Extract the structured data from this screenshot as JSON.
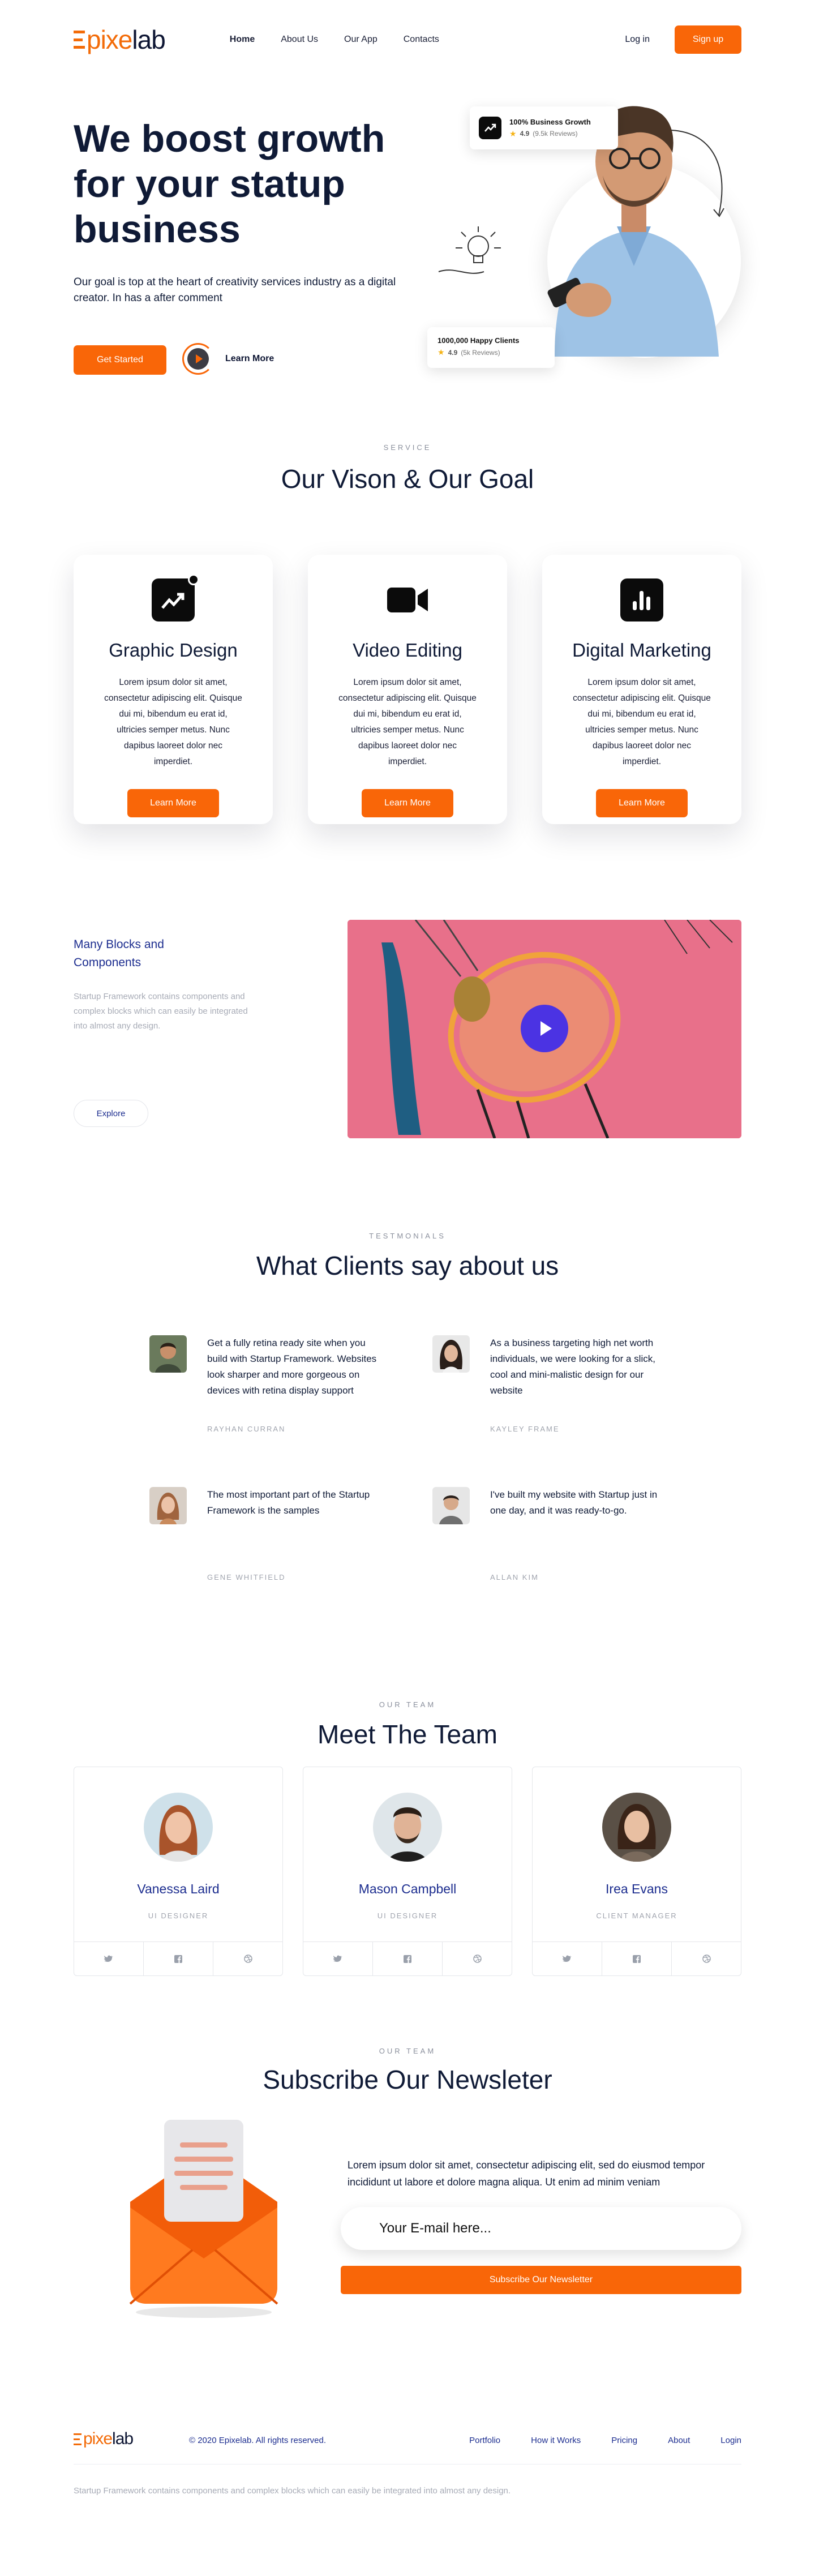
{
  "brand": {
    "logo_left": "pixe",
    "logo_right": "lab",
    "accent": "#f96608",
    "navy": "#0f1a36",
    "link_blue": "#1c2d8f"
  },
  "nav": {
    "items": [
      "Home",
      "About Us",
      "Our App",
      "Contacts"
    ],
    "login": "Log in",
    "signup": "Sign up"
  },
  "hero": {
    "title": "We boost growth for your statup business",
    "lead": "Our goal is top at the heart of creativity services industry as a digital creator. In has a after comment",
    "cta": "Get Started",
    "learn_more": "Learn More",
    "card_growth": {
      "title": "100% Business Growth",
      "rating": "4.9",
      "reviews": "(9.5k Reviews)"
    },
    "card_clients": {
      "title": "1000,000 Happy Clients",
      "rating": "4.9",
      "reviews": "(5k Reviews)"
    }
  },
  "services": {
    "kicker": "SERVICE",
    "title": "Our Vison & Our Goal",
    "cards": [
      {
        "icon": "growth-chart-icon",
        "title": "Graphic Design",
        "text": "Lorem ipsum dolor sit amet, consectetur adipiscing elit. Quisque dui mi, bibendum eu erat id, ultricies semper metus. Nunc dapibus laoreet dolor nec imperdiet.",
        "button": "Learn More"
      },
      {
        "icon": "video-camera-icon",
        "title": "Video Editing",
        "text": "Lorem ipsum dolor sit amet, consectetur adipiscing elit. Quisque dui mi, bibendum eu erat id, ultricies semper metus. Nunc dapibus laoreet dolor nec imperdiet.",
        "button": "Learn More"
      },
      {
        "icon": "bar-chart-icon",
        "title": "Digital Marketing",
        "text": "Lorem ipsum dolor sit amet, consectetur adipiscing elit. Quisque dui mi, bibendum eu erat id, ultricies semper metus. Nunc dapibus laoreet dolor nec imperdiet.",
        "button": "Learn More"
      }
    ]
  },
  "blocks": {
    "title": "Many Blocks and Components",
    "text": "Startup Framework contains components and complex blocks which can easily be integrated into almost any design.",
    "button": "Explore"
  },
  "testimonials": {
    "kicker": "TESTMONIALS",
    "title": "What Clients say about us",
    "items": [
      {
        "quote": "Get a fully retina ready site when you build with Startup Framework. Websites look sharper and more gorgeous on devices with retina display support",
        "name": "RAYHAN CURRAN"
      },
      {
        "quote": "As a business targeting high net worth individuals, we were looking for a slick, cool and mini-malistic design for our website",
        "name": "KAYLEY FRAME"
      },
      {
        "quote": "The most important part of the Startup Framework is the samples",
        "name": "GENE WHITFIELD"
      },
      {
        "quote": "I've built my website with Startup just in one day, and it was ready-to-go.",
        "name": "ALLAN KIM"
      }
    ]
  },
  "team": {
    "kicker": "OUR TEAM",
    "title": "Meet The Team",
    "members": [
      {
        "name": "Vanessa Laird",
        "role": "UI DESIGNER"
      },
      {
        "name": "Mason Campbell",
        "role": "UI DESIGNER"
      },
      {
        "name": "Irea Evans",
        "role": "CLIENT MANAGER"
      }
    ],
    "social_icons": [
      "twitter-icon",
      "facebook-icon",
      "dribbble-icon"
    ]
  },
  "newsletter": {
    "kicker": "OUR TEAM",
    "title": "Subscribe Our Newsleter",
    "text": "Lorem ipsum dolor sit amet, consectetur adipiscing elit, sed do eiusmod tempor incididunt ut labore et dolore magna aliqua. Ut enim ad minim veniam",
    "placeholder": "Your E-mail here...",
    "button": "Subscribe Our Newsletter"
  },
  "footer": {
    "copyright": "© 2020 Epixelab. All rights reserved.",
    "links": [
      "Portfolio",
      "How it Works",
      "Pricing",
      "About",
      "Login"
    ],
    "note": "Startup Framework contains components and complex blocks which can easily be integrated into almost any design."
  }
}
